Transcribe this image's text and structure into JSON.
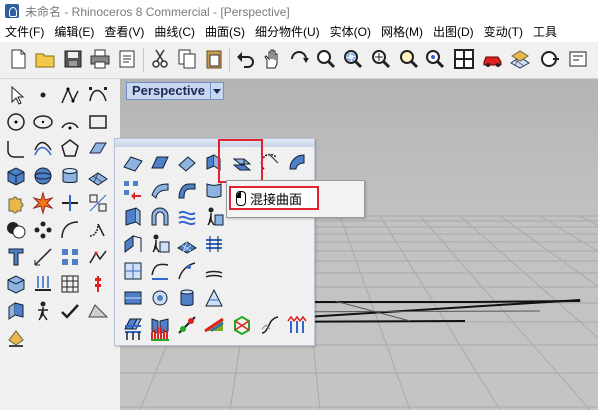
{
  "window": {
    "title": "未命名 - Rhinoceros 8 Commercial - [Perspective]"
  },
  "menu": [
    {
      "label": "文件(F)"
    },
    {
      "label": "编辑(E)"
    },
    {
      "label": "查看(V)"
    },
    {
      "label": "曲线(C)"
    },
    {
      "label": "曲面(S)"
    },
    {
      "label": "细分物件(U)"
    },
    {
      "label": "实体(O)"
    },
    {
      "label": "网格(M)"
    },
    {
      "label": "出图(D)"
    },
    {
      "label": "变动(T)"
    },
    {
      "label": "工具"
    }
  ],
  "viewport": {
    "tab_label": "Perspective"
  },
  "tooltip": {
    "label": "混接曲面"
  },
  "toolbar_icons": [
    "new-file-icon",
    "open-folder-icon",
    "save-icon",
    "print-icon",
    "import-icon",
    "cut-icon",
    "copy-icon",
    "paste-icon",
    "undo-icon",
    "pan-icon",
    "rotate-view-icon",
    "zoom-icon",
    "zoom-window-icon",
    "zoom-extents-icon",
    "zoom-selected-icon",
    "four-viewports-icon",
    "car-render-icon",
    "grid-layer-icon",
    "properties-icon",
    "more-icon"
  ],
  "colors": {
    "accent_red": "#e0232e",
    "viewport_bg": "#c2c3c1",
    "tab_blue": "#c9d8f0"
  }
}
